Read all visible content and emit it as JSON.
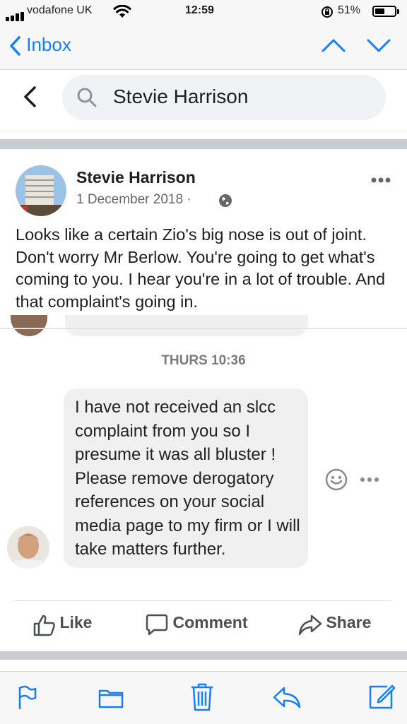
{
  "status_bar": {
    "carrier": "vodafone UK",
    "time": "12:59",
    "battery": "51%",
    "battery_level": 0.51
  },
  "mail_nav": {
    "back_label": "Inbox"
  },
  "search": {
    "query": "Stevie Harrison"
  },
  "post": {
    "author": "Stevie Harrison",
    "date": "1 December 2018 ·",
    "text": "Looks like a certain Zio's big nose is out of joint. Don't worry Mr Berlow. You're going to get what's coming to you. I hear you're in a lot of trouble. And that complaint's going in."
  },
  "message": {
    "timestamp": "THURS 10:36",
    "text": "I have not received an slcc complaint from you so I presume it was all bluster ! Please remove derogatory references on your social media page to my firm or I will take matters further."
  },
  "actions": {
    "like": "Like",
    "comment": "Comment",
    "share": "Share"
  },
  "colors": {
    "ios_blue": "#147efb",
    "fb_gray": "#4b4f56",
    "bubble": "#f0f0f0"
  }
}
